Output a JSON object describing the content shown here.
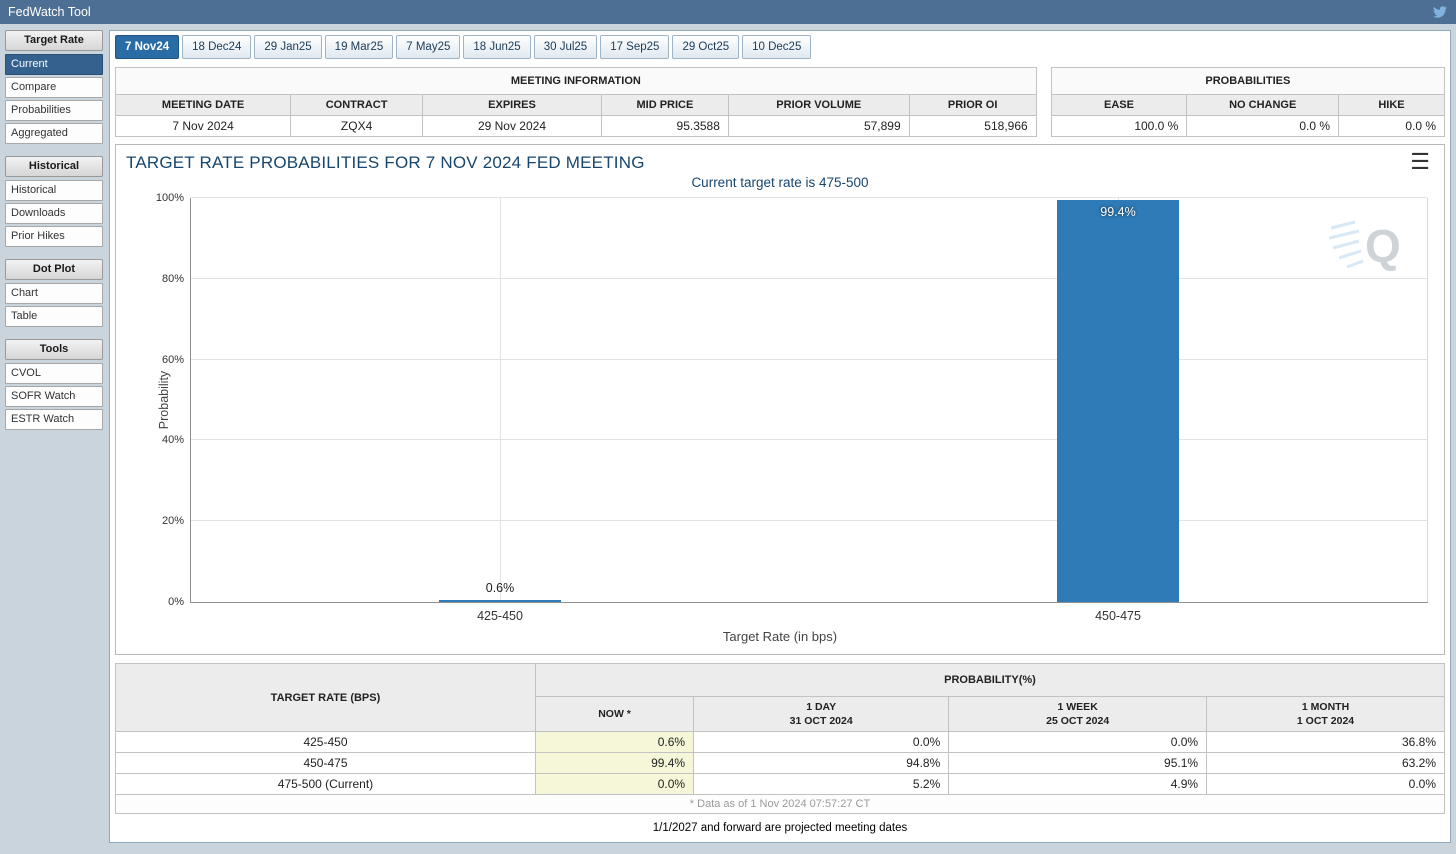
{
  "header": {
    "title": "FedWatch Tool",
    "twitter_icon": "twitter-bird"
  },
  "sidebar": {
    "sections": [
      {
        "label": "Target Rate",
        "items": [
          {
            "label": "Current",
            "active": true
          },
          {
            "label": "Compare",
            "active": false
          },
          {
            "label": "Probabilities",
            "active": false
          },
          {
            "label": "Aggregated",
            "active": false
          }
        ]
      },
      {
        "label": "Historical",
        "items": [
          {
            "label": "Historical",
            "active": false
          },
          {
            "label": "Downloads",
            "active": false
          },
          {
            "label": "Prior Hikes",
            "active": false
          }
        ]
      },
      {
        "label": "Dot Plot",
        "items": [
          {
            "label": "Chart",
            "active": false
          },
          {
            "label": "Table",
            "active": false
          }
        ]
      },
      {
        "label": "Tools",
        "items": [
          {
            "label": "CVOL",
            "active": false
          },
          {
            "label": "SOFR Watch",
            "active": false
          },
          {
            "label": "ESTR Watch",
            "active": false
          }
        ]
      }
    ]
  },
  "tabs": [
    {
      "label": "7 Nov24",
      "active": true
    },
    {
      "label": "18 Dec24",
      "active": false
    },
    {
      "label": "29 Jan25",
      "active": false
    },
    {
      "label": "19 Mar25",
      "active": false
    },
    {
      "label": "7 May25",
      "active": false
    },
    {
      "label": "18 Jun25",
      "active": false
    },
    {
      "label": "30 Jul25",
      "active": false
    },
    {
      "label": "17 Sep25",
      "active": false
    },
    {
      "label": "29 Oct25",
      "active": false
    },
    {
      "label": "10 Dec25",
      "active": false
    }
  ],
  "meeting_info": {
    "title": "MEETING INFORMATION",
    "columns": [
      "MEETING DATE",
      "CONTRACT",
      "EXPIRES",
      "MID PRICE",
      "PRIOR VOLUME",
      "PRIOR OI"
    ],
    "values": [
      "7 Nov 2024",
      "ZQX4",
      "29 Nov 2024",
      "95.3588",
      "57,899",
      "518,966"
    ]
  },
  "probabilities_panel": {
    "title": "PROBABILITIES",
    "columns": [
      "EASE",
      "NO CHANGE",
      "HIKE"
    ],
    "values": [
      "100.0 %",
      "0.0 %",
      "0.0 %"
    ]
  },
  "chart_data": {
    "type": "bar",
    "title": "TARGET RATE PROBABILITIES FOR 7 NOV 2024 FED MEETING",
    "subtitle": "Current target rate is 475-500",
    "categories": [
      "425-450",
      "450-475"
    ],
    "values": [
      0.6,
      99.4
    ],
    "value_labels": [
      "0.6%",
      "99.4%"
    ],
    "xlabel": "Target Rate (in bps)",
    "ylabel": "Probability",
    "ylim": [
      0,
      100
    ],
    "yticks": [
      "0%",
      "20%",
      "40%",
      "60%",
      "80%",
      "100%"
    ],
    "ytick_values": [
      0,
      20,
      40,
      60,
      80,
      100
    ],
    "category_positions_pct": [
      25,
      75
    ],
    "grid": true,
    "legend": "none",
    "bar_color": "#2e7bb8",
    "watermark": "Q"
  },
  "prob_table": {
    "rate_header": "TARGET RATE (BPS)",
    "group_header": "PROBABILITY(%)",
    "sub_headers": [
      {
        "line1": "NOW *",
        "line2": ""
      },
      {
        "line1": "1 DAY",
        "line2": "31 OCT 2024"
      },
      {
        "line1": "1 WEEK",
        "line2": "25 OCT 2024"
      },
      {
        "line1": "1 MONTH",
        "line2": "1 OCT 2024"
      }
    ],
    "rows": [
      {
        "rate": "425-450",
        "now": "0.6%",
        "day": "0.0%",
        "week": "0.0%",
        "month": "36.8%"
      },
      {
        "rate": "450-475",
        "now": "99.4%",
        "day": "94.8%",
        "week": "95.1%",
        "month": "63.2%"
      },
      {
        "rate": "475-500 (Current)",
        "now": "0.0%",
        "day": "5.2%",
        "week": "4.9%",
        "month": "0.0%"
      }
    ],
    "footnote": "* Data as of 1 Nov 2024 07:57:27 CT"
  },
  "footer_note": "1/1/2027 and forward are projected meeting dates",
  "colors": {
    "topbar_bg": "#4d6f93",
    "accent_blue": "#2a6da6",
    "bar_blue": "#2e7bb8",
    "title_text": "#17466e",
    "now_column_bg": "#f6f7d8"
  }
}
